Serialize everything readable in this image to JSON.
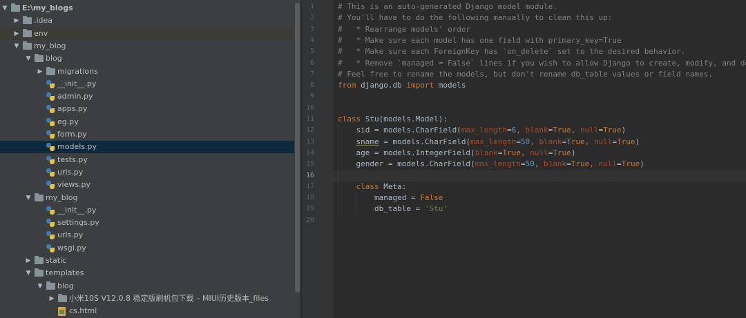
{
  "project_tree": {
    "items": [
      {
        "label": "E:\\my_blogs",
        "type": "folder",
        "expanded": true
      },
      {
        "label": ".idea",
        "type": "folder",
        "expanded": false
      },
      {
        "label": "env",
        "type": "folder",
        "expanded": false
      },
      {
        "label": "my_blog",
        "type": "folder",
        "expanded": true
      },
      {
        "label": "blog",
        "type": "folder",
        "expanded": true
      },
      {
        "label": "migrations",
        "type": "folder",
        "expanded": false
      },
      {
        "label": "__init__.py",
        "type": "python"
      },
      {
        "label": "admin.py",
        "type": "python"
      },
      {
        "label": "apps.py",
        "type": "python"
      },
      {
        "label": "eg.py",
        "type": "python"
      },
      {
        "label": "form.py",
        "type": "python"
      },
      {
        "label": "models.py",
        "type": "python",
        "selected": true
      },
      {
        "label": "tests.py",
        "type": "python"
      },
      {
        "label": "urls.py",
        "type": "python"
      },
      {
        "label": "views.py",
        "type": "python"
      },
      {
        "label": "my_blog",
        "type": "folder",
        "expanded": true
      },
      {
        "label": "__init__.py",
        "type": "python"
      },
      {
        "label": "settings.py",
        "type": "python"
      },
      {
        "label": "urls.py",
        "type": "python"
      },
      {
        "label": "wsgi.py",
        "type": "python"
      },
      {
        "label": "static",
        "type": "folder",
        "expanded": false
      },
      {
        "label": "templates",
        "type": "folder",
        "expanded": true
      },
      {
        "label": "blog",
        "type": "folder",
        "expanded": true
      },
      {
        "label": "小米10S V12.0.8 稳定版刷机包下载 – MIUI历史版本_files",
        "type": "folder",
        "expanded": false
      },
      {
        "label": "cs.html",
        "type": "html"
      }
    ]
  },
  "editor": {
    "file": "models.py",
    "current_line": "16",
    "line_numbers": [
      "1",
      "2",
      "3",
      "4",
      "5",
      "6",
      "7",
      "8",
      "9",
      "10",
      "11",
      "12",
      "13",
      "14",
      "15",
      "16",
      "17",
      "18",
      "19",
      "20"
    ],
    "lines": [
      "# This is an auto-generated Django model module.",
      "# You'll have to do the following manually to clean this up:",
      "#   * Rearrange models' order",
      "#   * Make sure each model has one field with primary_key=True",
      "#   * Make sure each ForeignKey has `on_delete` set to the desired behavior.",
      "#   * Remove `managed = False` lines if you wish to allow Django to create, modify, and de",
      "# Feel free to rename the models, but don't rename db_table values or field names.",
      "from django.db import models",
      "",
      "",
      "class Stu(models.Model):",
      "    sid = models.CharField(max_length=6, blank=True, null=True)",
      "    sname = models.CharField(max_length=50, blank=True, null=True)",
      "    age = models.IntegerField(blank=True, null=True)",
      "    gender = models.CharField(max_length=50, blank=True, null=True)",
      "",
      "    class Meta:",
      "        managed = False",
      "        db_table = 'Stu'",
      ""
    ]
  }
}
